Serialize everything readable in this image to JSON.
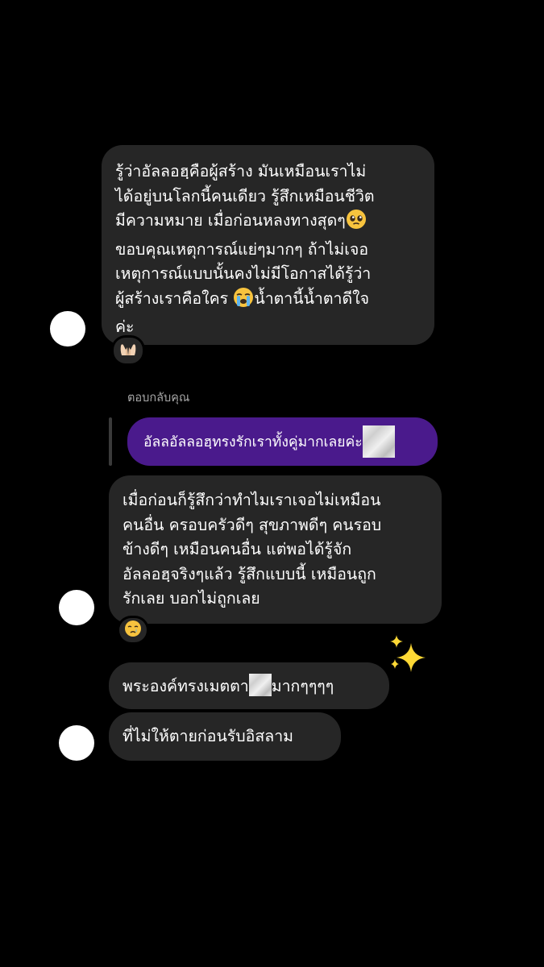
{
  "colors": {
    "background": "#000000",
    "incoming_bubble": "#262626",
    "quoted_bubble": "#4a1a8c",
    "reply_label": "#a8a8a8",
    "avatar": "#ffffff"
  },
  "messages": {
    "msg1": {
      "lines": [
        "รู้ว่าอัลลอฮฺคือผู้สร้าง มันเหมือนเราไม่",
        "ได้อยู่บนโลกนี้คนเดียว รู้สึกเหมือนชีวิต",
        "มีความหมาย เมื่อก่อนหลงทางสุดๆ",
        "ขอบคุณเหตุการณ์แย่ๆมากๆ ถ้าไม่เจอ",
        "เหตุการณ์แบบนั้นคงไม่มีโอกาสได้รู้ว่า",
        "ผู้สร้างเราคือใคร ",
        "น้ำตานี้น้ำตาดีใจ",
        "ค่ะ"
      ],
      "inline_emoji_1": "pleading-face-emoji",
      "inline_emoji_2": "loudly-crying-face-emoji",
      "reaction": "palms-up-together-emoji"
    },
    "reply": {
      "label": "ตอบกลับคุณ",
      "quoted_text": "อัลลอัลลอฮฺทรงรักเราทั้งคู่มากเลยค่ะ",
      "quoted_image": "blurred-sticker"
    },
    "msg2": {
      "lines": [
        "เมื่อก่อนก็รู้สึกว่าทำไมเราเจอไม่เหมือน",
        "คนอื่น ครอบครัวดีๆ สุขภาพดีๆ คนรอบ",
        "ข้างดีๆ เหมือนคนอื่น แต่พอได้รู้จัก",
        "อัลลอฮฺจริงๆแล้ว รู้สึกแบบนี้ เหมือนถูก",
        "รักเลย บอกไม่ถูกเลย"
      ],
      "reaction": "crying-face-emoji"
    },
    "sparkles": "sparkles-emoji",
    "msg3": {
      "text_before": "พระองค์ทรงเมตตา",
      "text_after": "มากๆๆๆๆ",
      "blurred": "blurred-sticker"
    },
    "msg4": {
      "text": "ที่ไม่ให้ตายก่อนรับอิสลาม"
    }
  }
}
